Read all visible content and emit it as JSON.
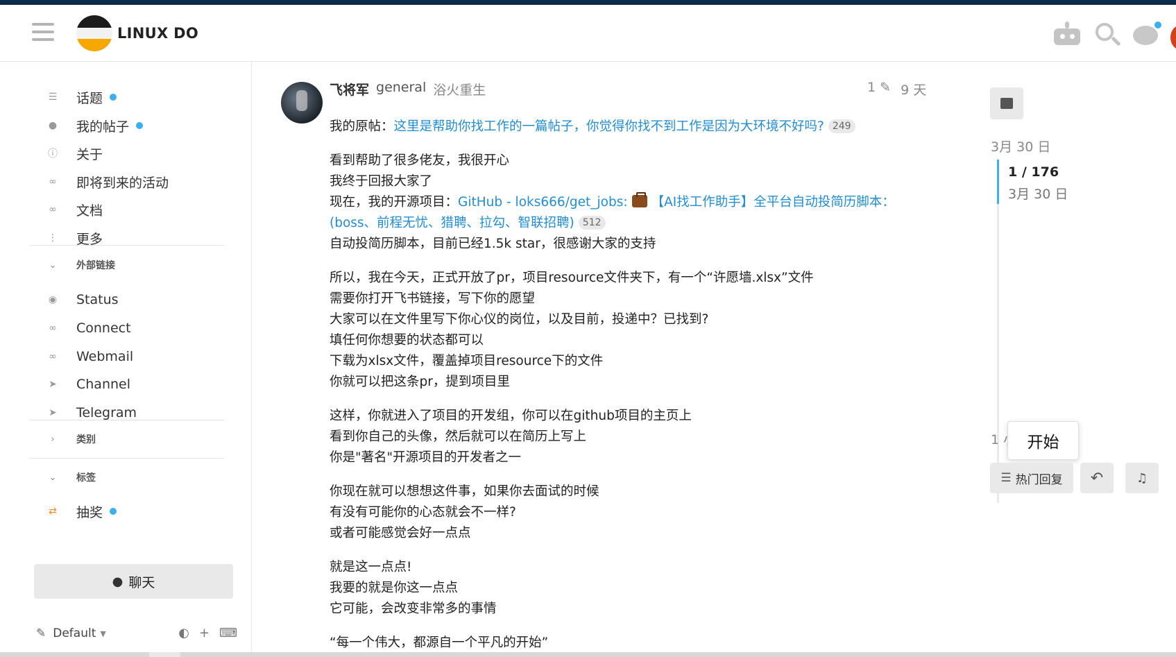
{
  "header": {
    "brand": "LINUX DO",
    "icons": [
      "hamburger-icon",
      "robot-icon",
      "search-icon",
      "chat-icon",
      "user-avatar"
    ]
  },
  "sidebar": {
    "items": [
      {
        "label": "话题",
        "icon": "layers-icon",
        "dot": true
      },
      {
        "label": "我的帖子",
        "icon": "user-icon",
        "dot": true
      },
      {
        "label": "关于",
        "icon": "info-icon",
        "dot": false
      },
      {
        "label": "即将到来的活动",
        "icon": "link-icon",
        "dot": false
      },
      {
        "label": "文档",
        "icon": "link-icon",
        "dot": false
      },
      {
        "label": "更多",
        "icon": "more-vertical-icon",
        "dot": false
      }
    ],
    "external_links_header": "外部链接",
    "external_links": [
      {
        "label": "Status",
        "icon": "eye-icon"
      },
      {
        "label": "Connect",
        "icon": "link-icon"
      },
      {
        "label": "Webmail",
        "icon": "link-icon"
      },
      {
        "label": "Channel",
        "icon": "paper-plane-icon"
      },
      {
        "label": "Telegram",
        "icon": "paper-plane-icon"
      }
    ],
    "categories_header": "类别",
    "tags_header": "标签",
    "tags": [
      {
        "label": "抽奖",
        "icon": "shuffle-icon",
        "dot": true
      }
    ],
    "chat_button": "聊天",
    "theme": "Default"
  },
  "post": {
    "username": "飞将军",
    "user_group": "general",
    "user_title": "浴火重生",
    "edit_count": "1",
    "age": "9 天",
    "original_prefix": "我的原帖：",
    "original_link": "这里是帮助你找工作的一篇帖子，你觉得你找不到工作是因为大环境不好吗?",
    "original_link_clicks": "249",
    "p2_line1": "看到帮助了很多佬友，我很开心",
    "p2_line2": "我终于回报大家了",
    "p2_line3_prefix": "现在，我的开源项目：",
    "p2_link_part1": "GitHub - loks666/get_jobs:",
    "p2_link_part2": "【AI找工作助手】全平台自动投简历脚本：(boss、前程无忧、猎聘、拉勾、智联招聘)",
    "p2_link_clicks": "512",
    "p2_line4": "自动投简历脚本，目前已经1.5k star，很感谢大家的支持",
    "p3_lines": [
      "所以，我在今天，正式开放了pr，项目resource文件夹下，有一个“许愿墙.xlsx”文件",
      "需要你打开飞书链接，写下你的愿望",
      "大家可以在文件里写下你心仪的岗位，以及目前，投递中？已找到?",
      "填任何你想要的状态都可以",
      "下载为xlsx文件，覆盖掉项目resource下的文件",
      "你就可以把这条pr，提到项目里"
    ],
    "p4_lines": [
      "这样，你就进入了项目的开发组，你可以在github项目的主页上",
      "看到你自己的头像，然后就可以在简历上写上",
      "你是\"著名\"开源项目的开发者之一"
    ],
    "p5_lines": [
      "你现在就可以想想这件事，如果你去面试的时候",
      "有没有可能你的心态就会不一样?",
      "或者可能感觉会好一点点"
    ],
    "p6_lines": [
      "就是这一点点!",
      "我要的就是你这一点点",
      "它可能，会改变非常多的事情"
    ],
    "p7_line": "“每一个伟大，都源自一个平凡的开始”"
  },
  "timeline": {
    "top_date": "3月 30 日",
    "position": "1 / 176",
    "position_date": "3月 30 日",
    "bottom_partial": "1 小",
    "tooltip": "开始",
    "hot_replies_button": "热门回复"
  },
  "colors": {
    "accent": "#3ab0f0",
    "link": "#1f8ed6",
    "top_bar": "#0d2b4a",
    "logo_yellow": "#f7a800"
  }
}
